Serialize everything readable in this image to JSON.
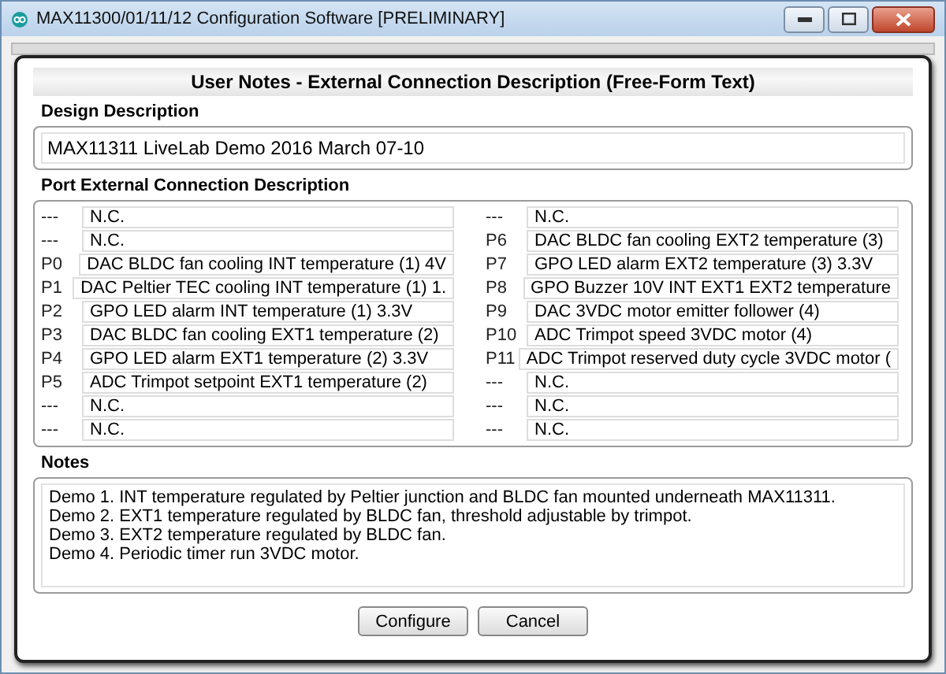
{
  "window": {
    "title": "MAX11300/01/11/12 Configuration Software [PRELIMINARY]"
  },
  "dialog": {
    "title": "User Notes - External Connection Description (Free-Form Text)",
    "design_label": "Design Description",
    "design_value": "MAX11311 LiveLab Demo 2016 March 07-10",
    "ports_label": "Port External Connection Description",
    "ports_left": [
      {
        "port": "---",
        "value": "N.C."
      },
      {
        "port": "---",
        "value": "N.C."
      },
      {
        "port": "P0",
        "value": "DAC BLDC fan cooling INT temperature (1) 4V"
      },
      {
        "port": "P1",
        "value": "DAC Peltier TEC cooling INT temperature (1) 1."
      },
      {
        "port": "P2",
        "value": "GPO LED alarm INT temperature (1) 3.3V"
      },
      {
        "port": "P3",
        "value": "DAC BLDC fan cooling EXT1 temperature (2)"
      },
      {
        "port": "P4",
        "value": "GPO LED alarm EXT1 temperature (2) 3.3V"
      },
      {
        "port": "P5",
        "value": "ADC Trimpot setpoint EXT1 temperature (2)"
      },
      {
        "port": "---",
        "value": "N.C."
      },
      {
        "port": "---",
        "value": "N.C."
      }
    ],
    "ports_right": [
      {
        "port": "---",
        "value": "N.C."
      },
      {
        "port": "P6",
        "value": "DAC BLDC fan cooling EXT2 temperature (3)"
      },
      {
        "port": "P7",
        "value": "GPO LED alarm EXT2 temperature (3) 3.3V"
      },
      {
        "port": "P8",
        "value": "GPO Buzzer 10V INT EXT1 EXT2 temperature"
      },
      {
        "port": "P9",
        "value": "DAC 3VDC motor emitter follower (4)"
      },
      {
        "port": "P10",
        "value": "ADC Trimpot speed 3VDC motor (4)"
      },
      {
        "port": "P11",
        "value": "ADC Trimpot reserved duty cycle 3VDC motor ("
      },
      {
        "port": "---",
        "value": "N.C."
      },
      {
        "port": "---",
        "value": "N.C."
      },
      {
        "port": "---",
        "value": "N.C."
      }
    ],
    "notes_label": "Notes",
    "notes": [
      "Demo 1. INT temperature regulated by Peltier junction and BLDC fan mounted underneath MAX11311.",
      "Demo 2. EXT1 temperature regulated by BLDC fan, threshold adjustable by trimpot.",
      "Demo 3. EXT2 temperature regulated by BLDC fan.",
      "Demo 4. Periodic timer run 3VDC motor."
    ],
    "buttons": [
      "Configure",
      "Cancel"
    ]
  }
}
